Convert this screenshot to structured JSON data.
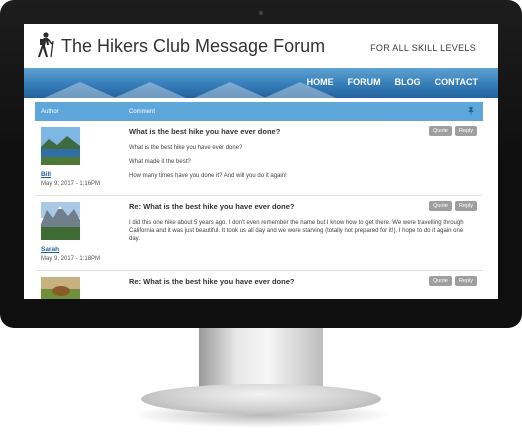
{
  "site": {
    "title": "The Hikers Club Message Forum",
    "tagline": "FOR ALL SKILL LEVELS"
  },
  "nav": {
    "items": [
      "HOME",
      "FORUM",
      "BLOG",
      "CONTACT"
    ]
  },
  "table": {
    "author_header": "Author",
    "comment_header": "Comment"
  },
  "buttons": {
    "quote": "Quote",
    "reply": "Reply"
  },
  "posts": [
    {
      "author": "Bill",
      "date": "May 9, 2017 - 1:16PM",
      "title": "What is the best hike you have ever done?",
      "body": [
        "What is the best hike you have ever done?",
        "What made it the best?",
        "How many times have you done it? And will you do it again!"
      ]
    },
    {
      "author": "Sarah",
      "date": "May 9, 2017 - 1:18PM",
      "title": "Re: What is the best hike you have ever done?",
      "body": [
        "I did this one hike about 5 years ago. I don't even remember the name but I know how to get there. We were travelling through California and it was just beautiful. It took us all day and we were starving (totally not prepared for it!). I hope to do it again one day."
      ]
    },
    {
      "author": "",
      "date": "",
      "title": "Re: What is the best hike you have ever done?",
      "body": []
    }
  ]
}
